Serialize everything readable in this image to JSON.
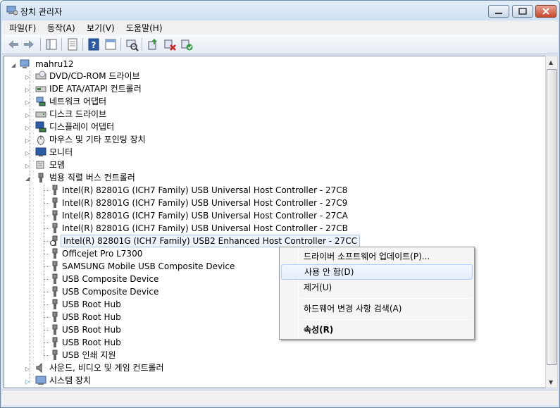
{
  "window": {
    "title": "장치 관리자"
  },
  "menu": [
    "파일(F)",
    "동작(A)",
    "보기(V)",
    "도움말(H)"
  ],
  "toolbar": {
    "icons": [
      "back-arrow-icon",
      "forward-arrow-icon",
      "show-hide-tree-icon",
      "properties-icon",
      "help-icon",
      "action-pane-icon",
      "scan-hardware-icon",
      "update-driver-icon",
      "uninstall-icon",
      "enable-device-icon"
    ]
  },
  "tree": {
    "root": "mahru12",
    "categories": [
      {
        "label": "DVD/CD-ROM 드라이브",
        "icon": "dvd-drive-icon"
      },
      {
        "label": "IDE ATA/ATAPI 컨트롤러",
        "icon": "ide-controller-icon"
      },
      {
        "label": "네트워크 어댑터",
        "icon": "network-adapter-icon"
      },
      {
        "label": "디스크 드라이브",
        "icon": "disk-drive-icon"
      },
      {
        "label": "디스플레이 어댑터",
        "icon": "display-adapter-icon"
      },
      {
        "label": "마우스 및 기타 포인팅 장치",
        "icon": "mouse-icon"
      },
      {
        "label": "모니터",
        "icon": "monitor-icon"
      },
      {
        "label": "모뎀",
        "icon": "modem-icon"
      },
      {
        "label": "범용 직렬 버스 컨트롤러",
        "icon": "usb-icon"
      }
    ],
    "usb_children": [
      "Intel(R) 82801G (ICH7 Family) USB Universal Host Controller - 27C8",
      "Intel(R) 82801G (ICH7 Family) USB Universal Host Controller - 27C9",
      "Intel(R) 82801G (ICH7 Family) USB Universal Host Controller - 27CA",
      "Intel(R) 82801G (ICH7 Family) USB Universal Host Controller - 27CB",
      "Intel(R) 82801G (ICH7 Family) USB2 Enhanced Host Controller - 27CC",
      "Officejet Pro L7300",
      "SAMSUNG Mobile USB Composite Device",
      "USB Composite Device",
      "USB Composite Device",
      "USB Root Hub",
      "USB Root Hub",
      "USB Root Hub",
      "USB Root Hub",
      "USB 인쇄 지원"
    ],
    "after": [
      {
        "label": "사운드, 비디오 및 게임 컨트롤러",
        "icon": "sound-icon"
      },
      {
        "label": "시스템 장치",
        "icon": "system-device-icon"
      }
    ]
  },
  "context_menu": {
    "items": [
      {
        "label": "드라이버 소프트웨어 업데이트(P)...",
        "bold": false
      },
      {
        "label": "사용 안 함(D)",
        "bold": false
      },
      {
        "label": "제거(U)",
        "bold": false
      },
      {
        "label": "하드웨어 변경 사항 검색(A)",
        "bold": false
      },
      {
        "label": "속성(R)",
        "bold": true
      }
    ]
  }
}
